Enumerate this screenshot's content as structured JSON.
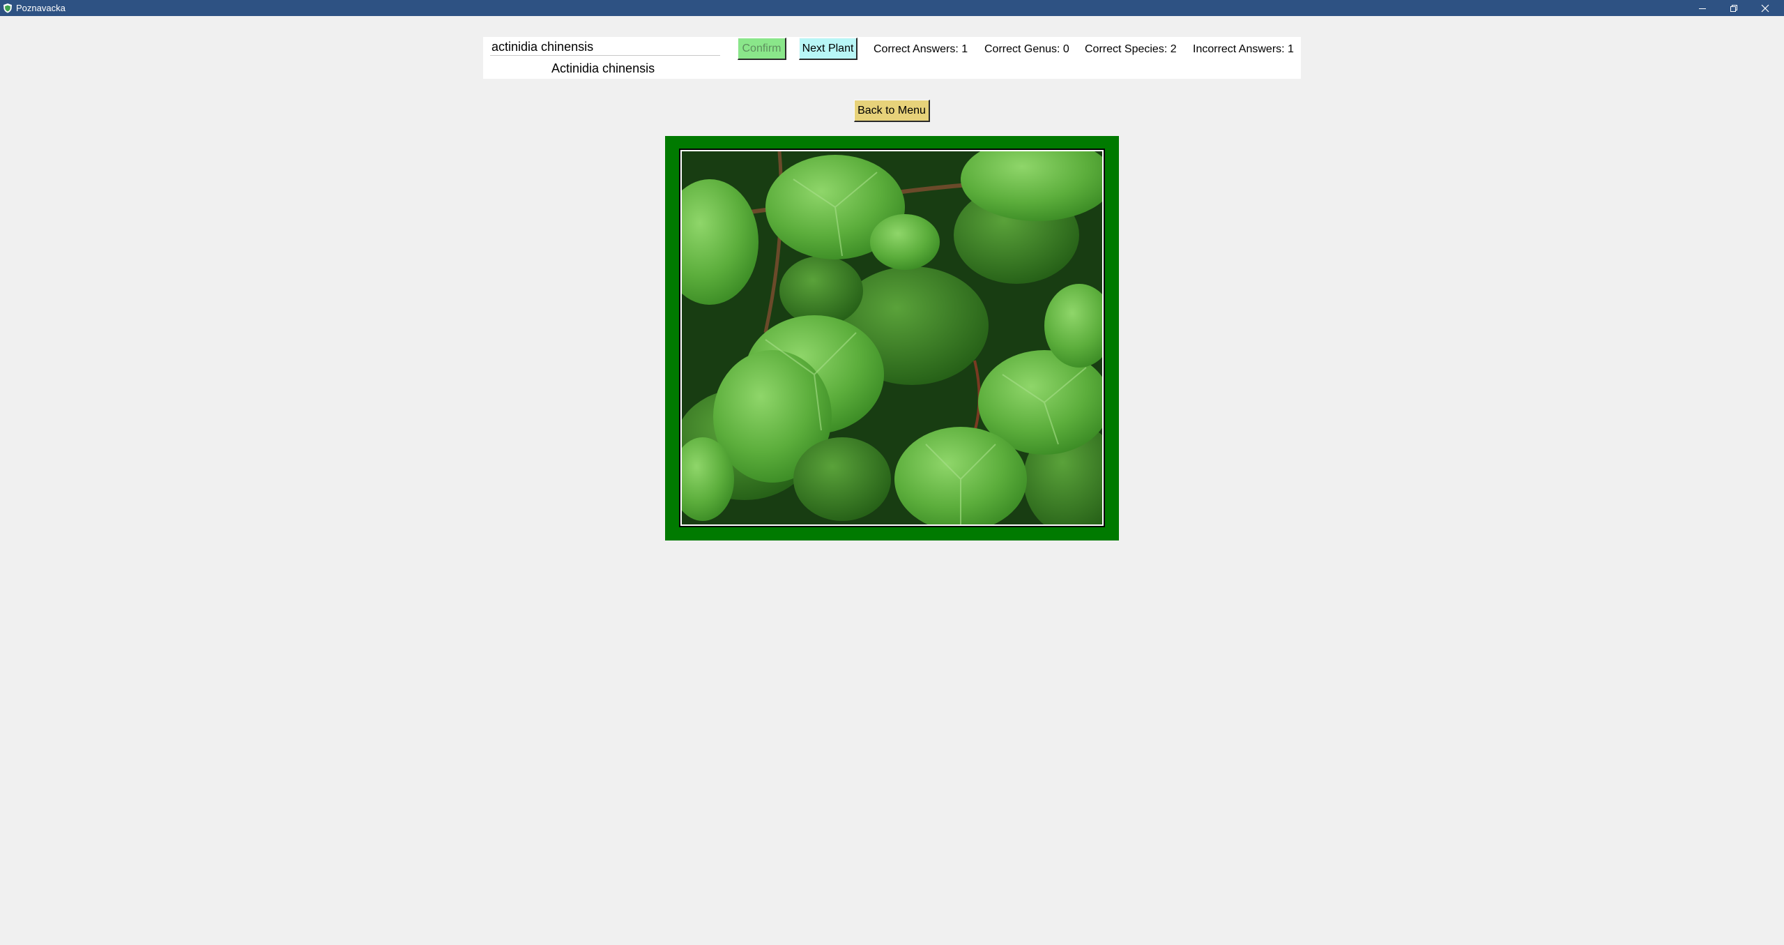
{
  "window": {
    "title": "Poznavacka",
    "icons": [
      "app-shield-icon",
      "minimize-icon",
      "restore-icon",
      "close-icon"
    ]
  },
  "quiz": {
    "answer_value": "actinidia chinensis",
    "suggestion": "Actinidia chinensis",
    "confirm_label": "Confirm",
    "next_label": "Next Plant",
    "stats": {
      "correct_answers": "Correct Answers: 1",
      "correct_genus": "Correct Genus: 0",
      "correct_species": "Correct Species: 2",
      "incorrect_answers": "Incorrect Answers: 1"
    },
    "back_label": "Back to Menu"
  },
  "colors": {
    "titlebar": "#2e5283",
    "confirm": "#8ae68a",
    "next": "#b8f6f6",
    "back": "#e7d27a",
    "frame": "#007a00"
  }
}
